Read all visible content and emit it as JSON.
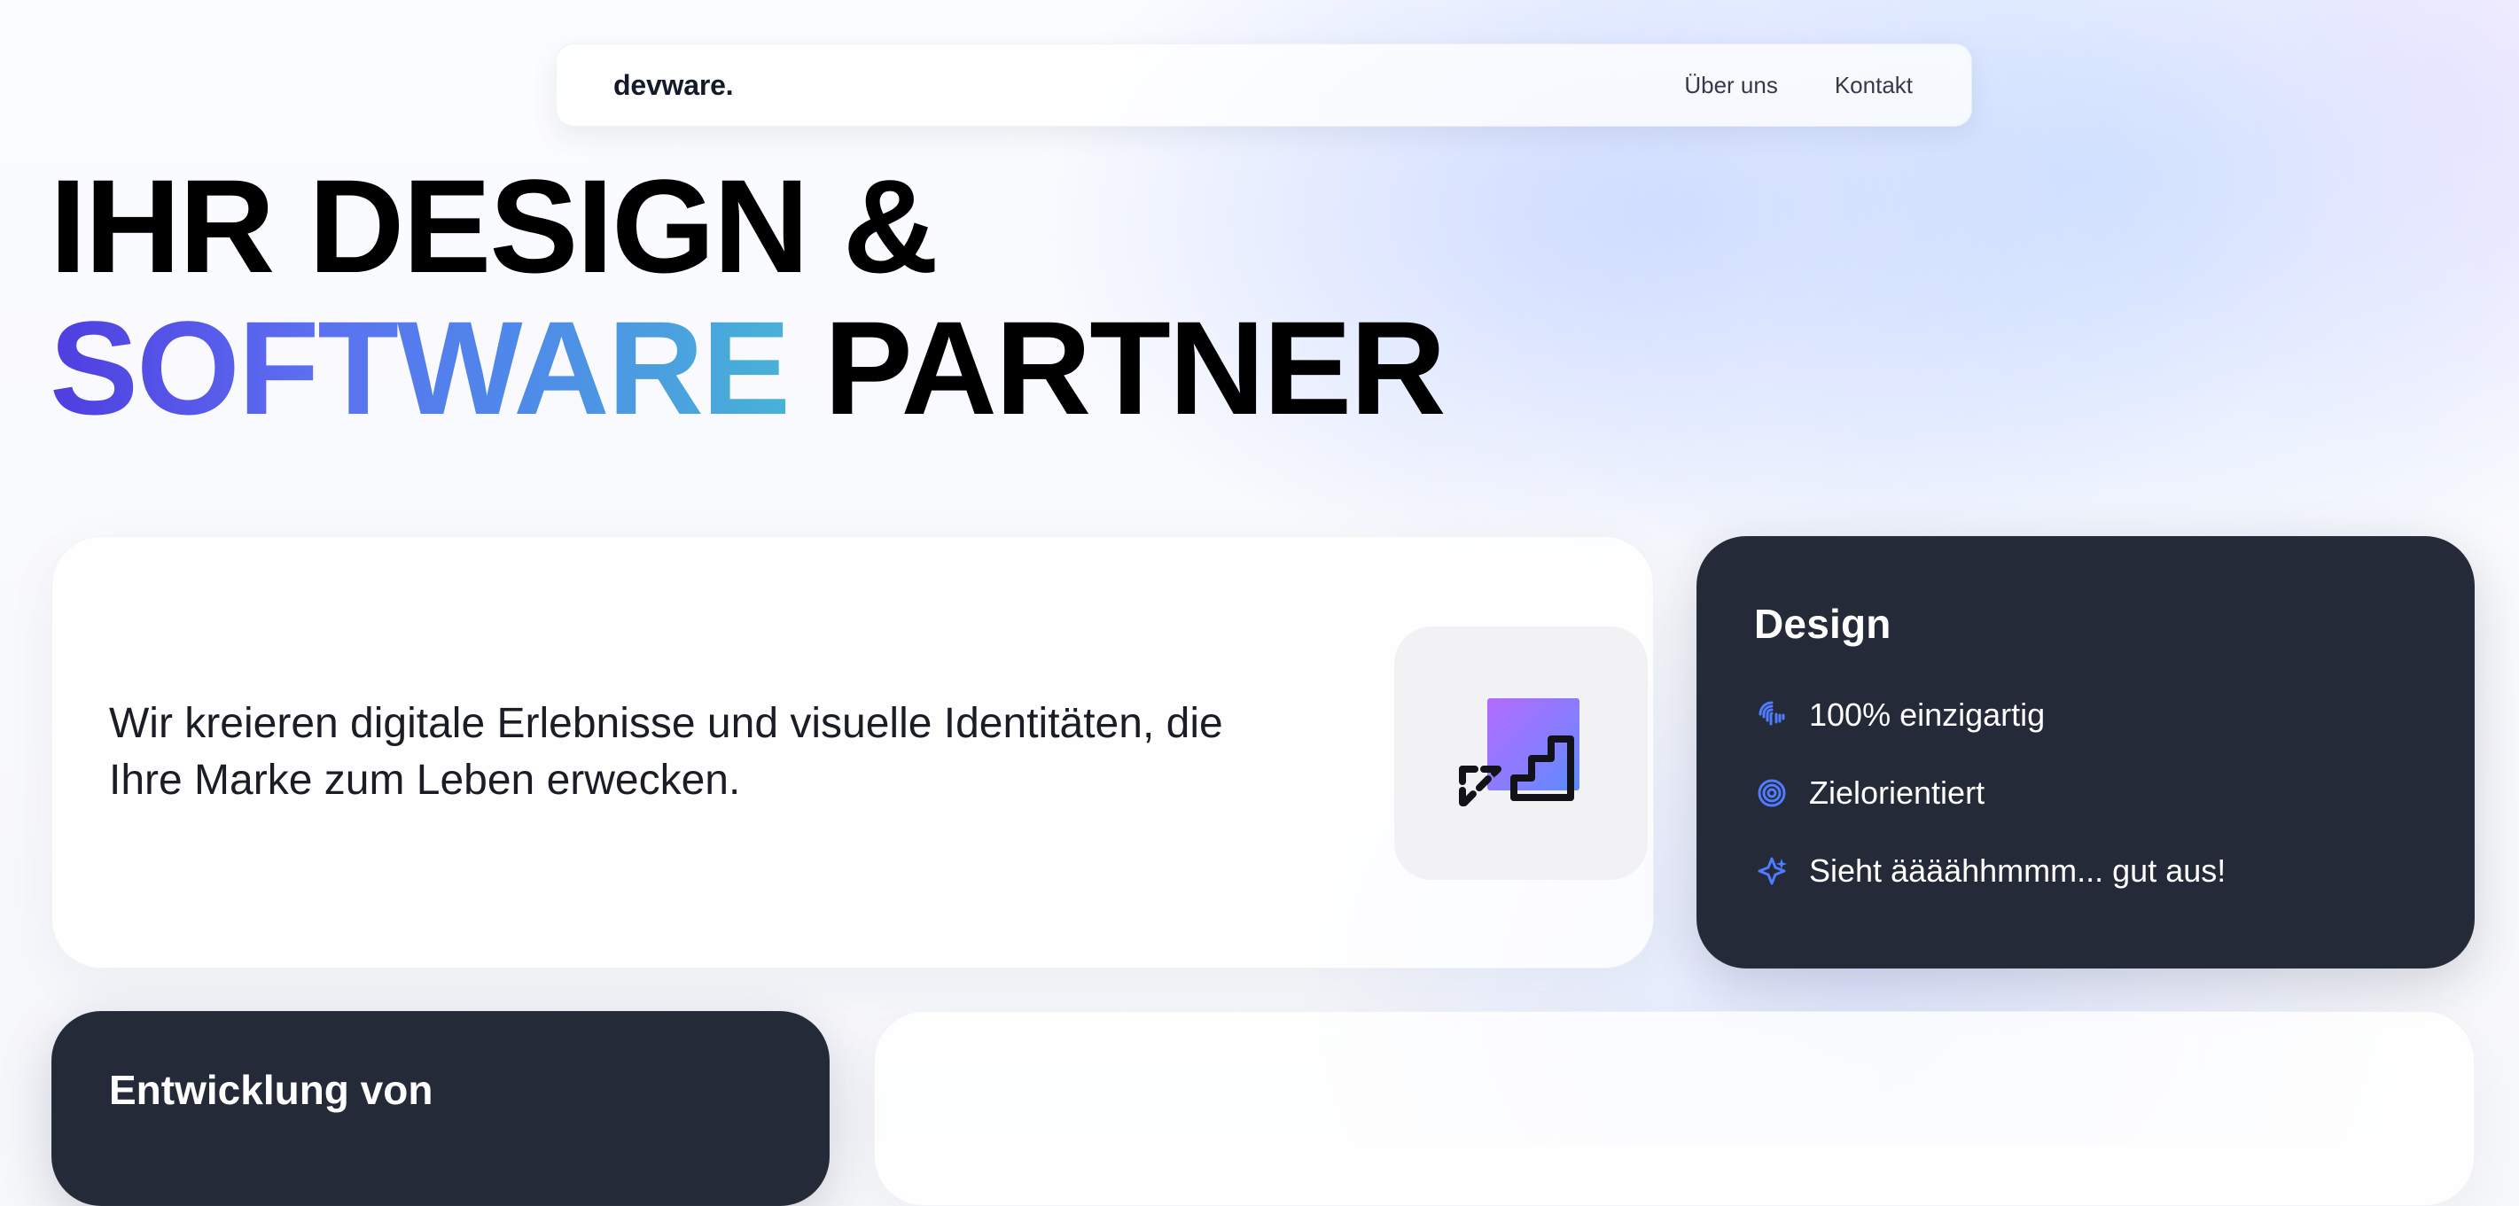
{
  "nav": {
    "brand": "devware.",
    "links": [
      {
        "label": "Über uns"
      },
      {
        "label": "Kontakt"
      }
    ]
  },
  "hero": {
    "line1": "IHR DESIGN &",
    "line2_gradient": "SOFTWARE",
    "line2_rest": " PARTNER"
  },
  "intro": {
    "text": "Wir kreieren digitale Erlebnisse und visuelle Identitäten, die Ihre Marke zum Leben erwecken."
  },
  "design_card": {
    "title": "Design",
    "features": [
      {
        "icon": "fingerprint-icon",
        "label": "100% einzigartig"
      },
      {
        "icon": "target-icon",
        "label": "Zielorientiert"
      },
      {
        "icon": "sparkle-icon",
        "label": "Sieht äääähhmmm... gut aus!"
      }
    ]
  },
  "dev_card": {
    "title": "Entwicklung von"
  },
  "colors": {
    "dark_card": "#252a39",
    "accent_blue": "#4f7cff",
    "accent_violet": "#b06cff"
  }
}
